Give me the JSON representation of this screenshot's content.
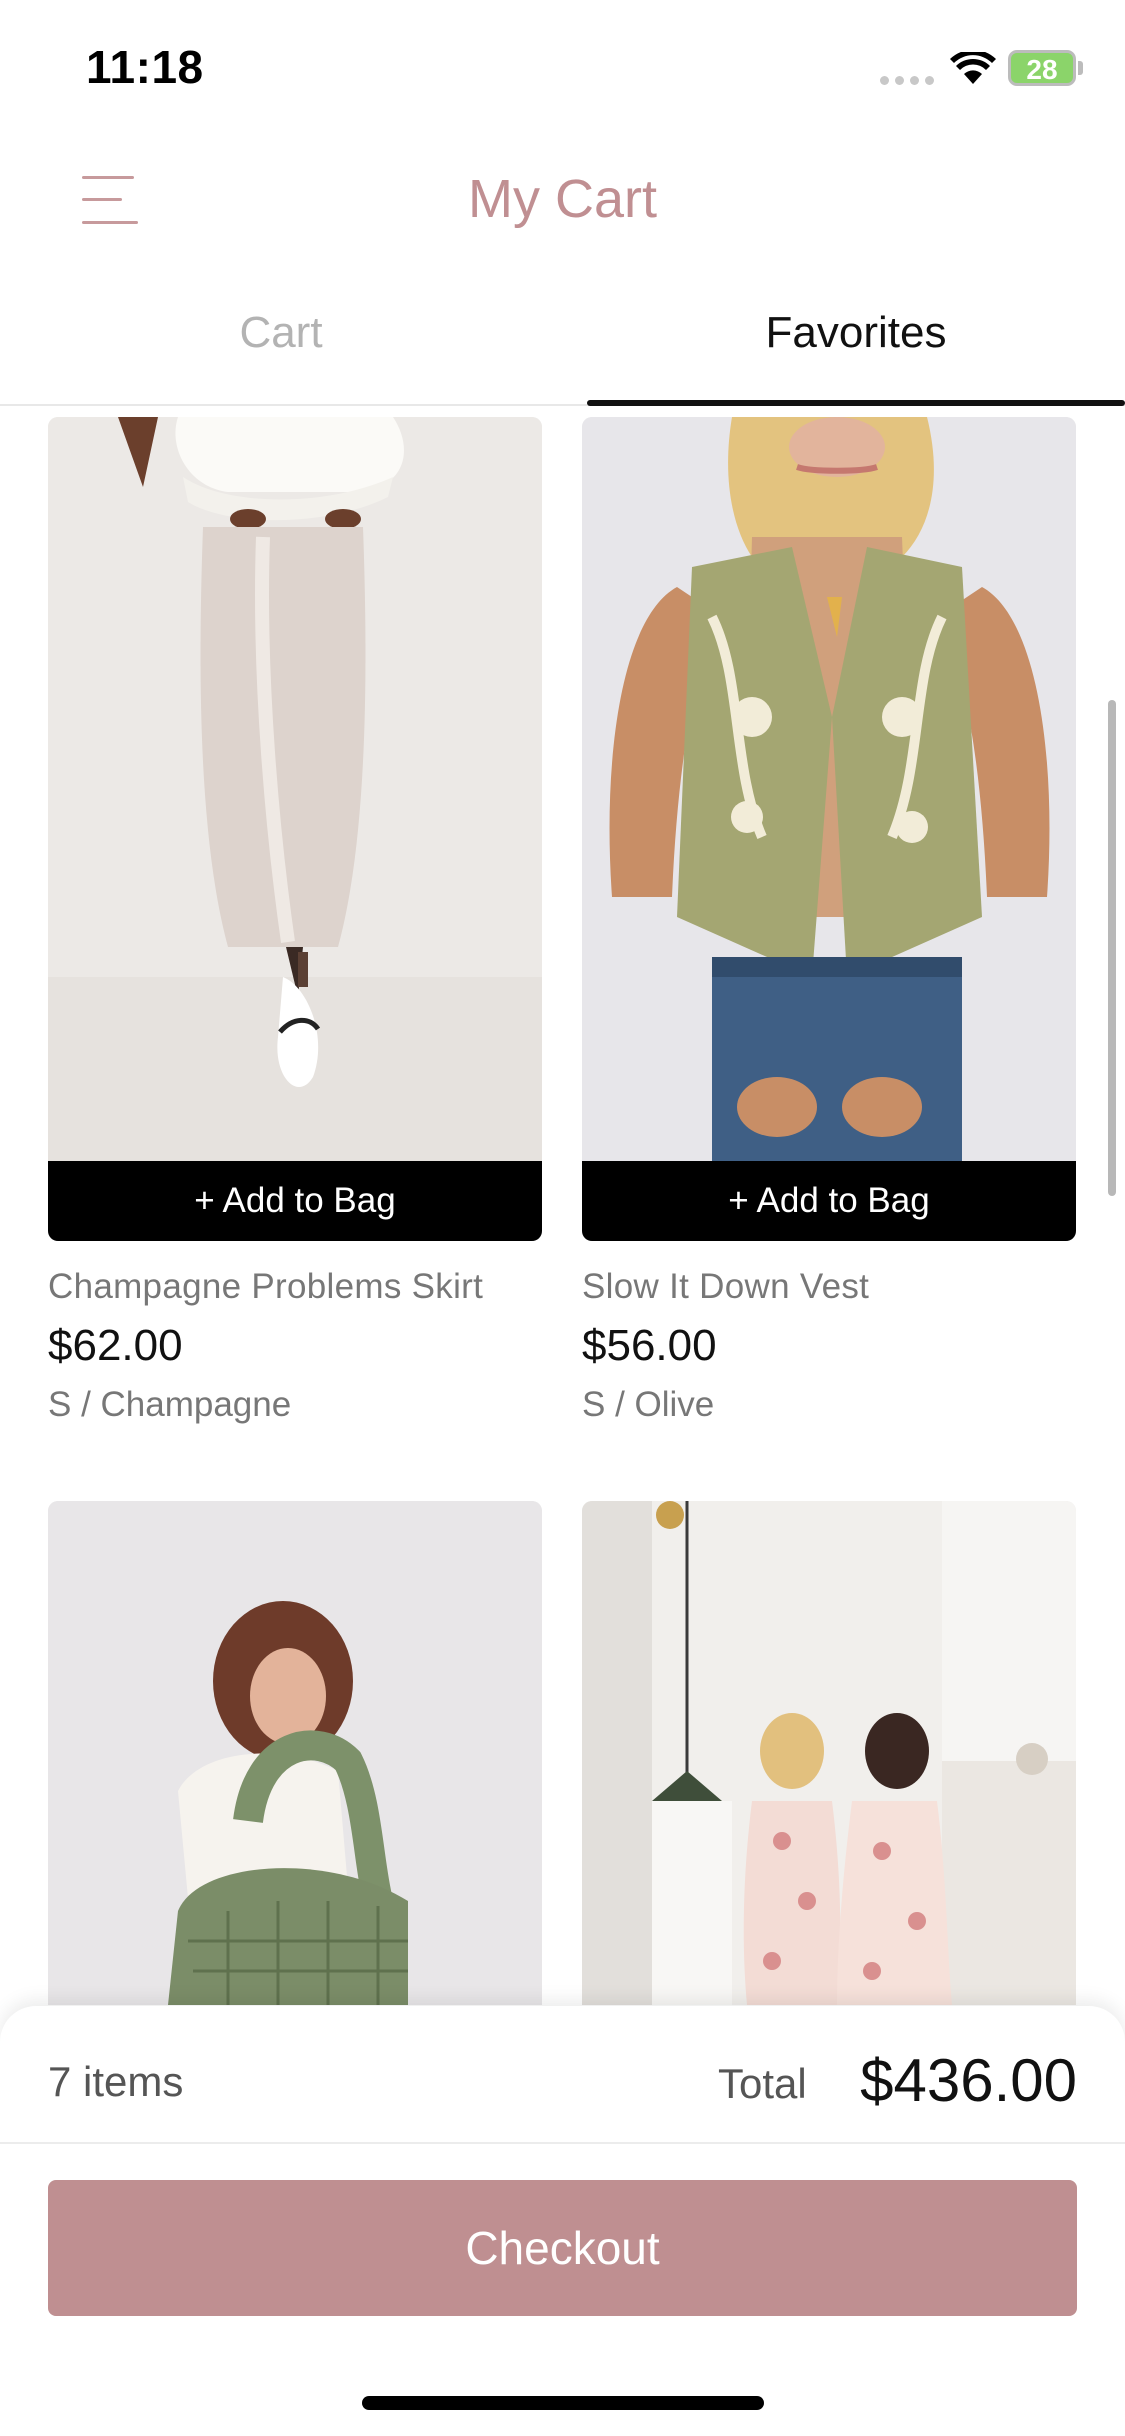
{
  "status_bar": {
    "time": "11:18",
    "battery": "28"
  },
  "header": {
    "title": "My Cart"
  },
  "tabs": [
    {
      "label": "Cart",
      "active": false
    },
    {
      "label": "Favorites",
      "active": true
    }
  ],
  "products": [
    {
      "name": "Champagne Problems Skirt",
      "price": "$62.00",
      "variant": "S / Champagne",
      "button": "+ Add to Bag"
    },
    {
      "name": "Slow It Down Vest",
      "price": "$56.00",
      "variant": "S / Olive",
      "button": "+ Add to Bag"
    },
    {
      "name": "",
      "price": "",
      "variant": "",
      "button": ""
    },
    {
      "name": "",
      "price": "",
      "variant": "",
      "button": ""
    }
  ],
  "summary": {
    "items": "7 items",
    "total_label": "Total",
    "total_value": "$436.00"
  },
  "checkout_label": "Checkout",
  "colors": {
    "accent": "#c08f92",
    "checkout": "#bf8f91",
    "tab_inactive": "#b3b3b3"
  }
}
